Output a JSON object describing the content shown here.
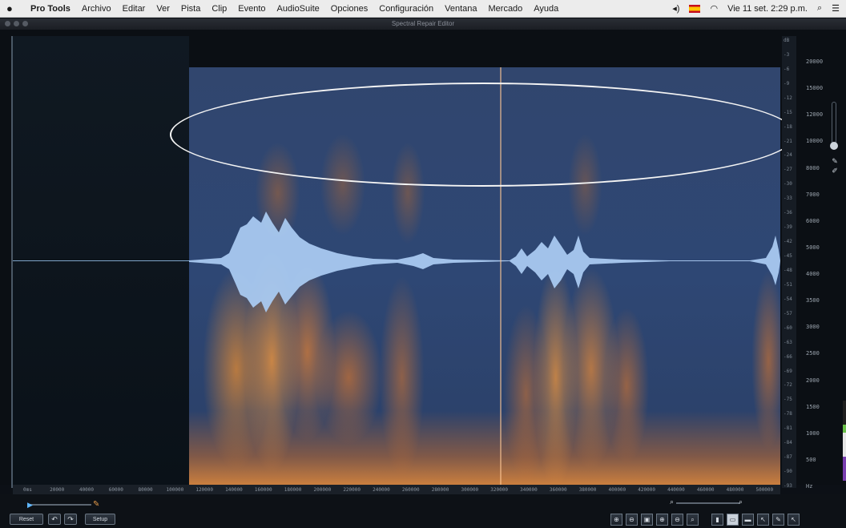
{
  "menubar": {
    "app_name": "Pro Tools",
    "items": [
      "Archivo",
      "Editar",
      "Ver",
      "Pista",
      "Clip",
      "Evento",
      "AudioSuite",
      "Opciones",
      "Configuración",
      "Ventana",
      "Mercado",
      "Ayuda"
    ],
    "clock": "Vie 11 set.  2:29 p.m."
  },
  "window": {
    "title": "Spectral Repair Editor"
  },
  "freq_scale": {
    "hz_labels": [
      "20000",
      "15000",
      "12000",
      "10000",
      "8000",
      "7000",
      "6000",
      "5000",
      "4000",
      "3500",
      "3000",
      "2500",
      "2000",
      "1500",
      "1000",
      "500",
      "Hz"
    ],
    "db_labels": [
      "dB",
      "-3",
      "-6",
      "-9",
      "-12",
      "-15",
      "-18",
      "-21",
      "-24",
      "-27",
      "-30",
      "-33",
      "-36",
      "-39",
      "-42",
      "-45",
      "-48",
      "-51",
      "-54",
      "-57",
      "-60",
      "-63",
      "-66",
      "-69",
      "-72",
      "-75",
      "-78",
      "-81",
      "-84",
      "-87",
      "-90",
      "-93"
    ]
  },
  "time_ruler": {
    "labels": [
      "0ms",
      "20000",
      "40000",
      "60000",
      "80000",
      "100000",
      "120000",
      "140000",
      "160000",
      "180000",
      "200000",
      "220000",
      "240000",
      "260000",
      "280000",
      "300000",
      "320000",
      "340000",
      "360000",
      "380000",
      "400000",
      "420000",
      "440000",
      "460000",
      "480000",
      "500000"
    ]
  },
  "bottombar": {
    "reset_label": "Reset",
    "undo_icon": "↶",
    "redo_icon": "↷",
    "settings_label": "Setup"
  },
  "tools": [
    {
      "name": "zoom-in-time-icon",
      "glyph": "⊕",
      "active": false
    },
    {
      "name": "zoom-out-time-icon",
      "glyph": "⊖",
      "active": false
    },
    {
      "name": "zoom-fit-icon",
      "glyph": "▣",
      "active": false
    },
    {
      "name": "zoom-in-freq-icon",
      "glyph": "⊕",
      "active": false
    },
    {
      "name": "zoom-out-freq-icon",
      "glyph": "⊖",
      "active": false
    },
    {
      "name": "magnify-icon",
      "glyph": "⌕",
      "active": false
    },
    {
      "name": "time-select-icon",
      "glyph": "▮",
      "active": false
    },
    {
      "name": "rect-select-icon",
      "glyph": "▭",
      "active": true
    },
    {
      "name": "freq-select-icon",
      "glyph": "▬",
      "active": false
    },
    {
      "name": "lasso-icon",
      "glyph": "↖",
      "active": false
    },
    {
      "name": "brush-icon",
      "glyph": "✎",
      "active": false
    },
    {
      "name": "arrow-icon",
      "glyph": "↖",
      "active": false
    }
  ]
}
